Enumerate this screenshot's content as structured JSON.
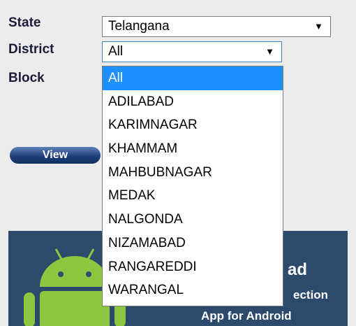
{
  "form": {
    "state_label": "State",
    "district_label": "District",
    "block_label": "Block",
    "state_value": "Telangana",
    "district_value": "All",
    "view_button": "View"
  },
  "dropdown": {
    "options": [
      "All",
      "ADILABAD",
      "KARIMNAGAR",
      "KHAMMAM",
      "MAHBUBNAGAR",
      "MEDAK",
      "NALGONDA",
      "NIZAMABAD",
      "RANGAREDDI",
      "WARANGAL"
    ],
    "selected": "All"
  },
  "banner": {
    "title_partial": "ad",
    "subtitle_partial": "ection",
    "subtitle2": "App for Android",
    "logo_icon": "android-robot-icon"
  },
  "colors": {
    "highlight": "#1e90ff",
    "banner_bg": "#2c4b6c",
    "android_green": "#8dc63f"
  }
}
